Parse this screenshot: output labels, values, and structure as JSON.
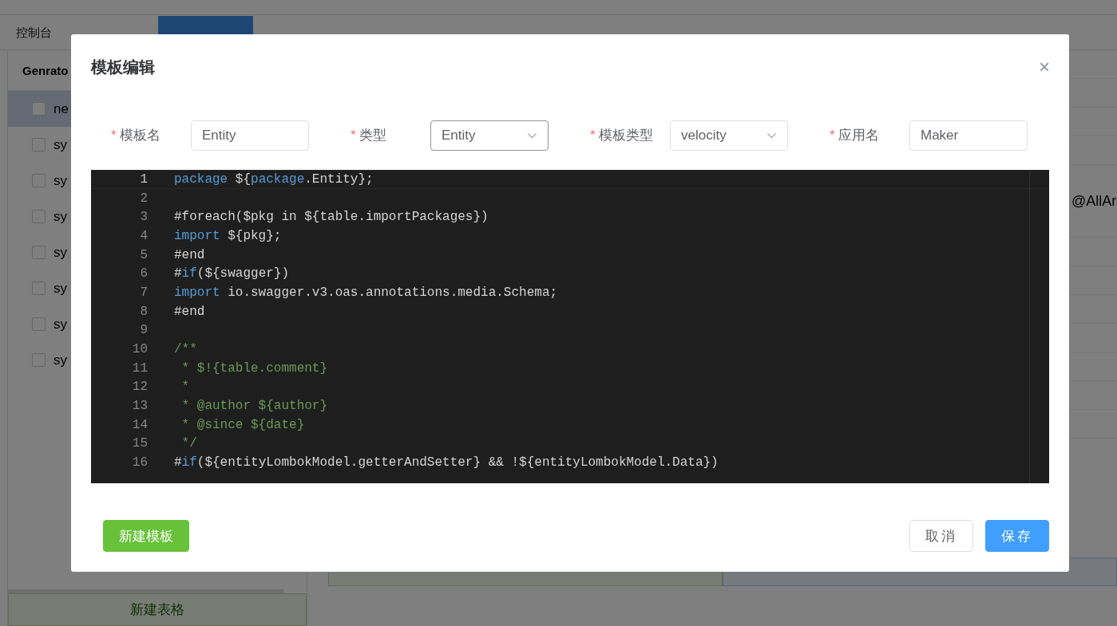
{
  "background": {
    "tabs": [
      {
        "label": "控制台",
        "selected": false
      },
      {
        "selected": false
      },
      {
        "selected": true
      }
    ],
    "panel_title": "Genrato",
    "list": [
      {
        "label": "ne",
        "selected": true,
        "checked": false
      },
      {
        "label": "sy",
        "selected": false,
        "checked": false
      },
      {
        "label": "sy",
        "selected": false,
        "checked": false
      },
      {
        "label": "sy",
        "selected": false,
        "checked": false
      },
      {
        "label": "sy",
        "selected": false,
        "checked": false
      },
      {
        "label": "sy",
        "selected": false,
        "checked": false
      },
      {
        "label": "sy",
        "selected": false,
        "checked": false
      },
      {
        "label": "sy",
        "selected": false,
        "checked": false
      }
    ],
    "detail_text": "@AllAr",
    "new_table_button": "新建表格"
  },
  "dialog": {
    "title": "模板编辑",
    "close": "×",
    "fields": [
      {
        "label": "模板名",
        "required": true,
        "kind": "input",
        "value": "Entity",
        "focused": false
      },
      {
        "label": "类型",
        "required": true,
        "kind": "select",
        "value": "Entity",
        "focused": true
      },
      {
        "label": "模板类型",
        "required": true,
        "kind": "select",
        "value": "velocity",
        "focused": false
      },
      {
        "label": "应用名",
        "required": true,
        "kind": "input",
        "value": "Maker",
        "focused": false
      }
    ],
    "code_lines": [
      {
        "number": "1",
        "current": true,
        "segments": [
          {
            "text": "package",
            "kind": "keyword"
          },
          {
            "text": " ${",
            "kind": "plain"
          },
          {
            "text": "package",
            "kind": "keyword"
          },
          {
            "text": ".Entity};",
            "kind": "plain"
          }
        ]
      },
      {
        "number": "2",
        "current": false
      },
      {
        "number": "3",
        "current": false,
        "segments": [
          {
            "text": "#foreach($pkg in ${table.importPackages})",
            "kind": "plain"
          }
        ]
      },
      {
        "number": "4",
        "current": false,
        "segments": [
          {
            "text": "import",
            "kind": "keyword"
          },
          {
            "text": " ${pkg};",
            "kind": "plain"
          }
        ]
      },
      {
        "number": "5",
        "current": false,
        "segments": [
          {
            "text": "#end",
            "kind": "plain"
          }
        ]
      },
      {
        "number": "6",
        "current": false,
        "segments": [
          {
            "text": "#",
            "kind": "plain"
          },
          {
            "text": "if",
            "kind": "keyword"
          },
          {
            "text": "(${swagger})",
            "kind": "plain"
          }
        ]
      },
      {
        "number": "7",
        "current": false,
        "segments": [
          {
            "text": "import",
            "kind": "keyword"
          },
          {
            "text": " io.swagger.v3.oas.annotations.media.Schema;",
            "kind": "plain"
          }
        ]
      },
      {
        "number": "8",
        "current": false,
        "segments": [
          {
            "text": "#end",
            "kind": "plain"
          }
        ]
      },
      {
        "number": "9",
        "current": false
      },
      {
        "number": "10",
        "current": false,
        "segments": [
          {
            "text": "/**",
            "kind": "comment"
          }
        ]
      },
      {
        "number": "11",
        "current": false,
        "segments": [
          {
            "text": " * $!{table.comment}",
            "kind": "comment"
          }
        ]
      },
      {
        "number": "12",
        "current": false,
        "segments": [
          {
            "text": " *",
            "kind": "comment"
          }
        ]
      },
      {
        "number": "13",
        "current": false,
        "segments": [
          {
            "text": " * @author ${author}",
            "kind": "comment"
          }
        ]
      },
      {
        "number": "14",
        "current": false,
        "segments": [
          {
            "text": " * @since ${date}",
            "kind": "comment"
          }
        ]
      },
      {
        "number": "15",
        "current": false,
        "segments": [
          {
            "text": " */",
            "kind": "comment"
          }
        ]
      },
      {
        "number": "16",
        "current": false,
        "segments": [
          {
            "text": "#",
            "kind": "plain"
          },
          {
            "text": "if",
            "kind": "keyword"
          },
          {
            "text": "(${entityLombokModel.getterAndSetter} && !${entityLombokModel.Data})",
            "kind": "plain"
          }
        ]
      }
    ],
    "new_template_button": "新建模板",
    "cancel_button": "取消",
    "save_button": "保存"
  }
}
